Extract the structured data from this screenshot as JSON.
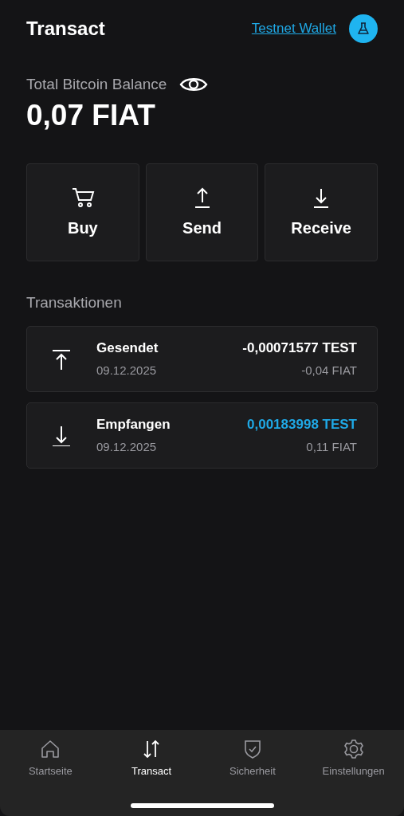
{
  "header": {
    "title": "Transact",
    "network_link": "Testnet Wallet"
  },
  "balance": {
    "label": "Total Bitcoin Balance",
    "amount": "0,07 FIAT"
  },
  "actions": [
    {
      "kind": "buy",
      "label": "Buy"
    },
    {
      "kind": "send",
      "label": "Send"
    },
    {
      "kind": "receive",
      "label": "Receive"
    }
  ],
  "transactions_title": "Transaktionen",
  "transactions": [
    {
      "kind": "sent",
      "title": "Gesendet",
      "date": "09.12.2025",
      "amount": "-0,00071577 TEST",
      "fiat": "-0,04 FIAT"
    },
    {
      "kind": "received",
      "title": "Empfangen",
      "date": "09.12.2025",
      "amount": "0,00183998 TEST",
      "fiat": "0,11 FIAT"
    }
  ],
  "tabs": [
    {
      "kind": "home",
      "label": "Startseite",
      "selected": false
    },
    {
      "kind": "transact",
      "label": "Transact",
      "selected": true
    },
    {
      "kind": "security",
      "label": "Sicherheit",
      "selected": false
    },
    {
      "kind": "settings",
      "label": "Einstellungen",
      "selected": false
    }
  ]
}
